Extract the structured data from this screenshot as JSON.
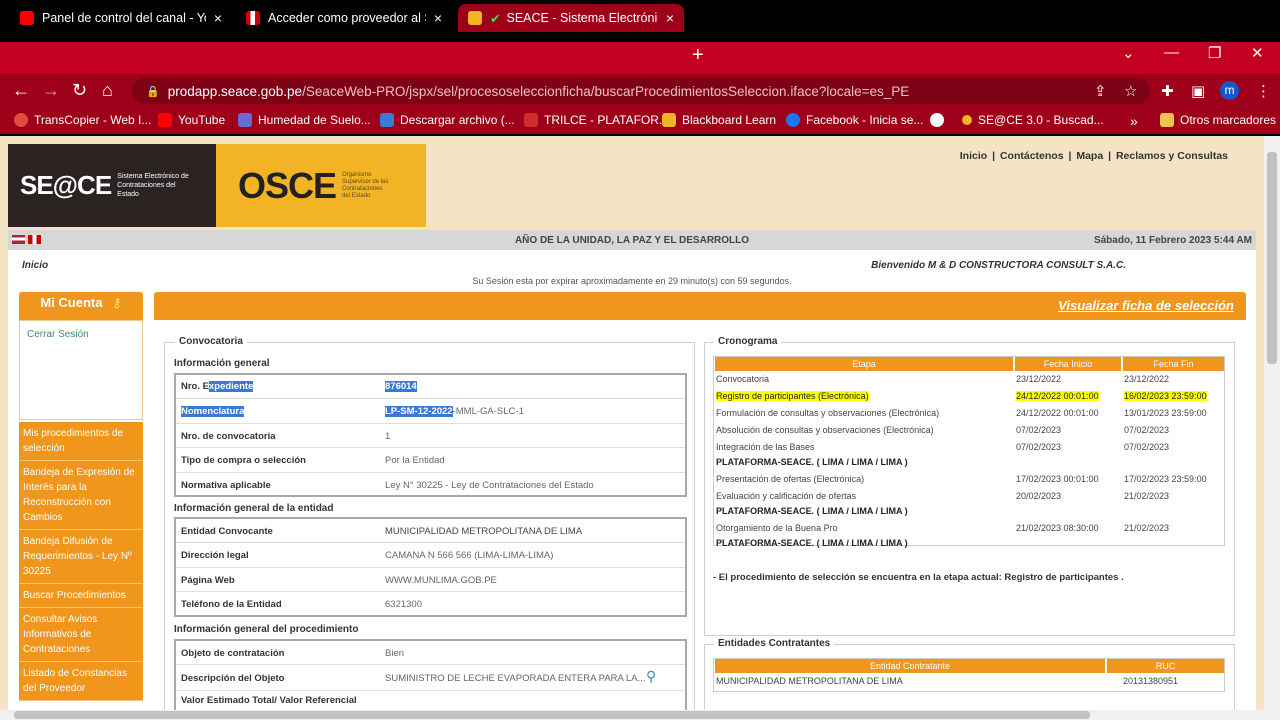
{
  "browser": {
    "tabs": [
      {
        "title": "Panel de control del canal - YouT",
        "close": "×",
        "icon_color": "#ff0000"
      },
      {
        "title": "Acceder como proveedor al Siste",
        "close": "×",
        "icon_color": "#d10000"
      },
      {
        "title": "SEACE - Sistema Electrónico de",
        "close": "×",
        "icon_color": "#f2b324"
      }
    ],
    "new_tab": "+",
    "url_domain": "prodapp.seace.gob.pe",
    "url_path": "/SeaceWeb-PRO/jspx/sel/procesoseleccionficha/buscarProcedimientosSeleccion.iface?locale=es_PE",
    "avatar_letter": "m",
    "bookmarks": [
      {
        "label": "TransCopier - Web I...",
        "color": "#e14b3c"
      },
      {
        "label": "YouTube",
        "color": "#ff0000"
      },
      {
        "label": "Humedad de Suelo...",
        "color": "#6b6bd6"
      },
      {
        "label": "Descargar archivo (...",
        "color": "#3a7bd5"
      },
      {
        "label": "TRILCE - PLATAFOR...",
        "color": "#d12c2c"
      },
      {
        "label": "Blackboard Learn",
        "color": "#f2b324"
      },
      {
        "label": "Facebook - Inicia se...",
        "color": "#1877f2"
      },
      {
        "label": "",
        "color": "#ffffff"
      },
      {
        "label": "SE@CE 3.0 - Buscad...",
        "color": "#f2b324"
      }
    ],
    "more_bookmarks": "»",
    "other_bookmarks": "Otros marcadores"
  },
  "header": {
    "logo_seace": "SE@CE",
    "logo_seace_sub": "Sistema Electrónico de Contrataciones del Estado",
    "logo_osce": "OSCE",
    "logo_osce_sub": "Organismo Supervisor de las Contrataciones del Estado",
    "links": [
      "Inicio",
      "Contáctenos",
      "Mapa",
      "Reclamos y Consultas"
    ],
    "motto": "AÑO DE LA UNIDAD, LA PAZ Y EL DESARROLLO",
    "date": "Sábado, 11 Febrero 2023 5:44 AM"
  },
  "session": {
    "breadcrumb": "Inicio",
    "welcome": "Bienvenido  M & D CONSTRUCTORA CONSULT S.A.C.",
    "expiry": "Su Sesión esta por expirar aproximadamente en 29 minuto(s) con 59 segundos."
  },
  "sidebar": {
    "title": "Mi Cuenta",
    "logout": "Cerrar Sesión",
    "items": [
      "Mis procedimientos de selección",
      "Bandeja de Expresión de Interés para la Reconstrucción con Cambios",
      "Bandeja Difusión de Requerimientos - Ley Nº 30225",
      "Buscar Procedimientos",
      "Consultar Avisos Informativos de Contrataciones",
      "Listado de Constancias del Proveedor"
    ]
  },
  "main": {
    "banner": "Visualizar ficha de selección",
    "convocatoria": {
      "legend": "Convocatoria",
      "general_title": "Información general",
      "general_rows": [
        {
          "k_pre": "Nro. E",
          "k_hl": "xpediente",
          "v_hl": "876014",
          "v_rest": ""
        },
        {
          "k_pre": "",
          "k_hl": "Nomenclatura",
          "v_hl": "LP-SM-12-2022",
          "v_rest": "-MML-GA-SLC-1"
        },
        {
          "k_pre": "Nro. de convocatoria",
          "k_hl": "",
          "v_hl": "",
          "v_rest": "1"
        },
        {
          "k_pre": "Tipo de compra o selección",
          "k_hl": "",
          "v_hl": "",
          "v_rest": "Por la Entidad"
        },
        {
          "k_pre": "Normativa aplicable",
          "k_hl": "",
          "v_hl": "",
          "v_rest": "Ley N° 30225 - Ley de Contrataciones del Estado"
        }
      ],
      "entity_title": "Información general de la entidad",
      "entity_rows": [
        {
          "k": "Entidad Convocante",
          "v": "MUNICIPALIDAD METROPOLITANA DE LIMA"
        },
        {
          "k": "Dirección legal",
          "v": "CAMANA N 566 566 (LIMA-LIMA-LIMA)"
        },
        {
          "k": "Página Web",
          "v": "WWW.MUNLIMA.GOB.PE"
        },
        {
          "k": "Teléfono de la Entidad",
          "v": "6321300"
        }
      ],
      "proc_title": "Información general del procedimiento",
      "proc_rows": [
        {
          "k": "Objeto de contratación",
          "v": "Bien"
        },
        {
          "k": "Descripción del Objeto",
          "v": "SUMINISTRO DE LECHE EVAPORADA ENTERA PARA LA..."
        },
        {
          "k": "Valor Estimado Total/ Valor Referencial",
          "v": ""
        }
      ]
    },
    "cronograma": {
      "legend": "Cronograma",
      "headers": [
        "Etapa",
        "Fecha Inicio",
        "Fecha Fin"
      ],
      "rows": [
        {
          "etapa": "Convocatoria",
          "sub": "",
          "inicio": "23/12/2022",
          "fin": "23/12/2022"
        },
        {
          "etapa": "Registro de participantes (Electrónica)",
          "sub": "",
          "inicio": "24/12/2022 00:01:00",
          "fin": "16/02/2023 23:59:00"
        },
        {
          "etapa": "Formulación de consultas y observaciones (Electrónica)",
          "sub": "",
          "inicio": "24/12/2022 00:01:00",
          "fin": "13/01/2023 23:59:00"
        },
        {
          "etapa": "Absolución de consultas y observaciones (Electrónica)",
          "sub": "",
          "inicio": "07/02/2023",
          "fin": "07/02/2023"
        },
        {
          "etapa": "Integración de las Bases",
          "sub": "PLATAFORMA-SEACE. ( LIMA / LIMA / LIMA )",
          "inicio": "07/02/2023",
          "fin": "07/02/2023"
        },
        {
          "etapa": "Presentación de ofertas (Electrónica)",
          "sub": "",
          "inicio": "17/02/2023 00:01:00",
          "fin": "17/02/2023 23:59:00"
        },
        {
          "etapa": "Evaluación y calificación de ofertas",
          "sub": "PLATAFORMA-SEACE. ( LIMA / LIMA / LIMA )",
          "inicio": "20/02/2023",
          "fin": "21/02/2023"
        },
        {
          "etapa": "Otorgamiento de la Buena Pro",
          "sub": "PLATAFORMA-SEACE. ( LIMA / LIMA / LIMA )",
          "inicio": "21/02/2023 08:30:00",
          "fin": "21/02/2023"
        }
      ],
      "note": "- El procedimiento de selección se encuentra en la etapa actual: Registro de participantes ."
    },
    "entidades": {
      "legend": "Entidades Contratantes",
      "headers": [
        "Entidad Contratante",
        "RUC"
      ],
      "row": {
        "entidad": "MUNICIPALIDAD METROPOLITANA DE LIMA",
        "ruc": "20131380951"
      }
    }
  }
}
